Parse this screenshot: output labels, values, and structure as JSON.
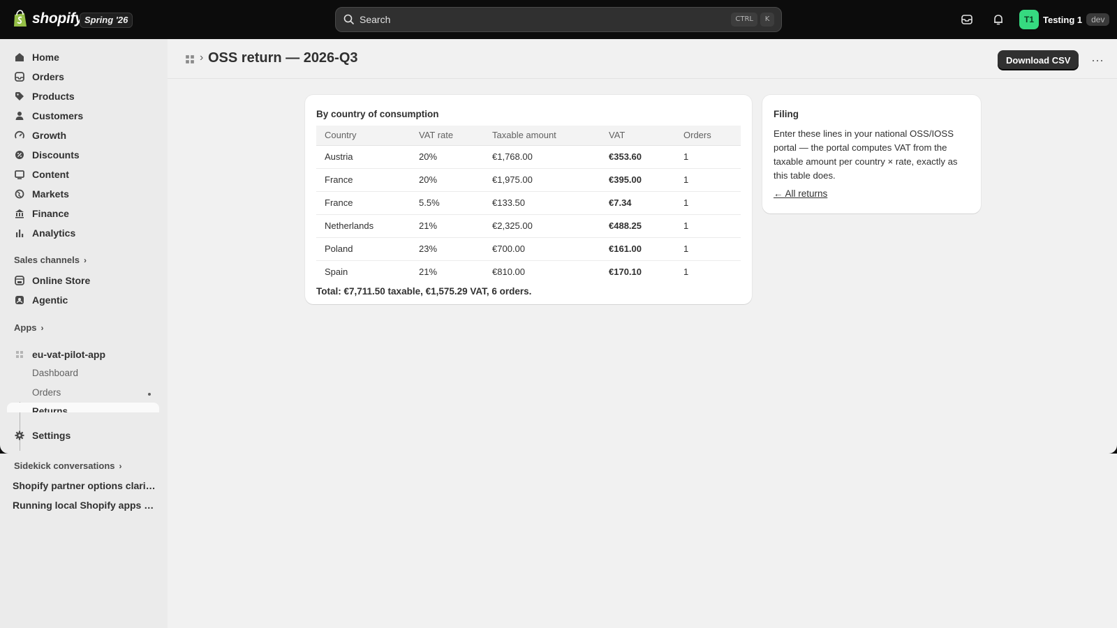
{
  "topbar": {
    "brand": "shopify",
    "release_badge": "Spring '26",
    "search_placeholder": "Search",
    "shortcut_keys": [
      "CTRL",
      "K"
    ],
    "user": {
      "initials": "T1",
      "name": "Testing 1",
      "tag": "dev"
    }
  },
  "sidebar": {
    "nav": [
      {
        "label": "Home",
        "icon": "home-icon"
      },
      {
        "label": "Orders",
        "icon": "orders-icon"
      },
      {
        "label": "Products",
        "icon": "tag-icon"
      },
      {
        "label": "Customers",
        "icon": "person-icon"
      },
      {
        "label": "Growth",
        "icon": "gauge-icon"
      },
      {
        "label": "Discounts",
        "icon": "discount-icon"
      },
      {
        "label": "Content",
        "icon": "content-icon"
      },
      {
        "label": "Markets",
        "icon": "globe-icon"
      },
      {
        "label": "Finance",
        "icon": "bank-icon"
      },
      {
        "label": "Analytics",
        "icon": "bar-chart-icon"
      }
    ],
    "sales_channels_label": "Sales channels",
    "channels": [
      {
        "label": "Online Store",
        "icon": "store-icon"
      },
      {
        "label": "Agentic",
        "icon": "agentic-icon"
      }
    ],
    "apps_label": "Apps",
    "app": {
      "name": "eu-vat-pilot-app",
      "sub_items": [
        "Dashboard",
        "Orders",
        "Returns"
      ]
    },
    "settings_label": "Settings",
    "sidekick_label": "Sidekick conversations",
    "conversations": [
      "Shopify partner options clarified",
      "Running local Shopify apps wit..."
    ]
  },
  "page": {
    "title": "OSS return — 2026-Q3",
    "download_label": "Download CSV",
    "more_label": "···"
  },
  "country_card": {
    "title": "By country of consumption",
    "columns": [
      "Country",
      "VAT rate",
      "Taxable amount",
      "VAT",
      "Orders"
    ],
    "rows": [
      [
        "Austria",
        "20%",
        "€1,768.00",
        "€353.60",
        "1"
      ],
      [
        "France",
        "20%",
        "€1,975.00",
        "€395.00",
        "1"
      ],
      [
        "France",
        "5.5%",
        "€133.50",
        "€7.34",
        "1"
      ],
      [
        "Netherlands",
        "21%",
        "€2,325.00",
        "€488.25",
        "1"
      ],
      [
        "Poland",
        "23%",
        "€700.00",
        "€161.00",
        "1"
      ],
      [
        "Spain",
        "21%",
        "€810.00",
        "€170.10",
        "1"
      ]
    ],
    "total": "Total: €7,711.50 taxable, €1,575.29 VAT, 6 orders."
  },
  "filing_card": {
    "title": "Filing",
    "body": "Enter these lines in your national OSS/IOSS portal — the portal computes VAT from the taxable amount per country × rate, exactly as this table does.",
    "link": "← All returns"
  }
}
